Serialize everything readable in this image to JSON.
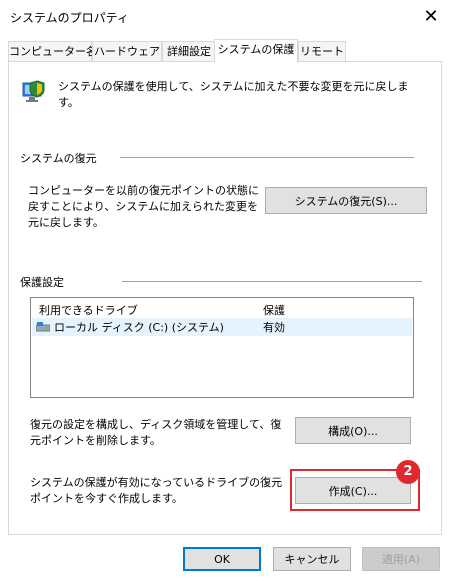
{
  "window": {
    "title": "システムのプロパティ",
    "close_glyph": "✕"
  },
  "tabs": [
    {
      "label": "コンピューター名"
    },
    {
      "label": "ハードウェア"
    },
    {
      "label": "詳細設定"
    },
    {
      "label": "システムの保護"
    },
    {
      "label": "リモート"
    }
  ],
  "intro": {
    "text": "システムの保護を使用して、システムに加えた不要な変更を元に戻します。",
    "icon": "shield-computer-icon"
  },
  "restore": {
    "heading": "システムの復元",
    "description": "コンピューターを以前の復元ポイントの状態に戻すことにより、システムに加えられた変更を元に戻します。",
    "button": "システムの復元(S)..."
  },
  "protection": {
    "heading": "保護設定",
    "columns": [
      "利用できるドライブ",
      "保護"
    ],
    "drives": [
      {
        "name": "ローカル ディスク (C:) (システム)",
        "status": "有効",
        "icon": "drive-icon"
      }
    ],
    "configure_desc": "復元の設定を構成し、ディスク領域を管理して、復元ポイントを削除します。",
    "configure_button": "構成(O)...",
    "create_desc": "システムの保護が有効になっているドライブの復元ポイントを今すぐ作成します。",
    "create_button": "作成(C)..."
  },
  "annotation": {
    "badge": "2",
    "color": "#e0282f"
  },
  "footer": {
    "ok": "OK",
    "cancel": "キャンセル",
    "apply": "適用(A)"
  }
}
